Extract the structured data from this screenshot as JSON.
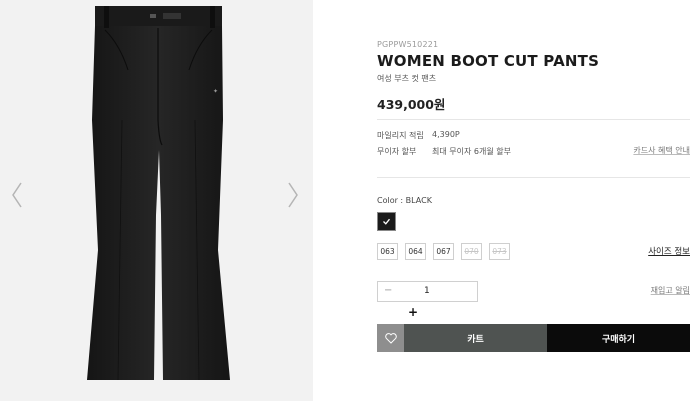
{
  "product": {
    "sku": "PGPPW510221",
    "name": "WOMEN BOOT CUT PANTS",
    "subtitle": "여성 부츠 컷 팬츠",
    "price": "439,000원",
    "image_icon": "black-bootcut-pants",
    "color": "#1b1b1b"
  },
  "meta": {
    "mileage_label": "마일리지 적립",
    "mileage_value": "4,390P",
    "installment_label": "무이자 할부",
    "installment_value": "최대 무이자 6개월 할부",
    "card_benefit_link": "카드사 혜택 안내"
  },
  "options": {
    "color_label": "Color : BLACK",
    "selected_color": "#1b1b1b",
    "sizes": [
      {
        "label": "063",
        "available": true
      },
      {
        "label": "064",
        "available": true
      },
      {
        "label": "067",
        "available": true
      },
      {
        "label": "070",
        "available": false
      },
      {
        "label": "073",
        "available": false
      }
    ],
    "size_guide_link": "사이즈 정보"
  },
  "quantity": {
    "minus_symbol": "−",
    "value": "1",
    "plus_symbol": "+"
  },
  "restock_link": "재입고 알림",
  "actions": {
    "wishlist_icon": "heart-icon",
    "cart_label": "카트",
    "buy_label": "구매하기"
  }
}
